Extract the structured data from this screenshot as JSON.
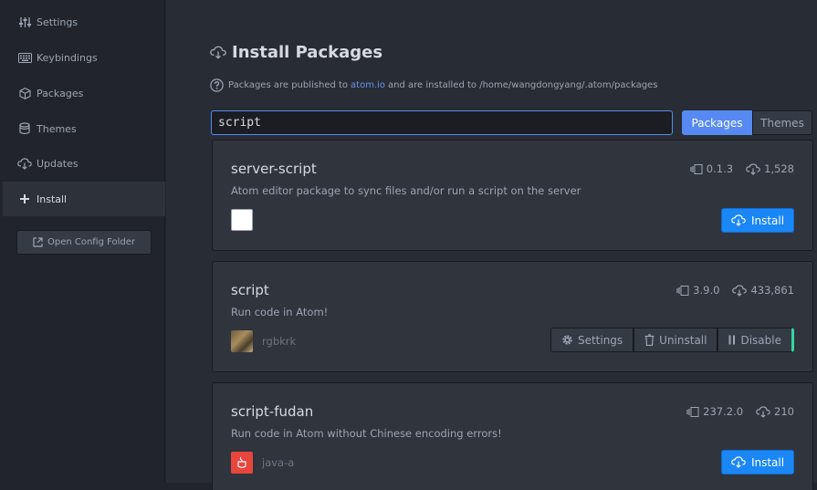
{
  "sidebar": {
    "items": [
      {
        "label": "Settings",
        "icon": "sliders-icon"
      },
      {
        "label": "Keybindings",
        "icon": "keyboard-icon"
      },
      {
        "label": "Packages",
        "icon": "package-icon"
      },
      {
        "label": "Themes",
        "icon": "paintcan-icon"
      },
      {
        "label": "Updates",
        "icon": "cloud-download-icon"
      },
      {
        "label": "Install",
        "icon": "plus-icon"
      }
    ],
    "active": "Install",
    "config_button": "Open Config Folder"
  },
  "main": {
    "title": "Install Packages",
    "info_prefix": "Packages are published to",
    "info_link": "atom.io",
    "info_suffix": "and are installed to /home/wangdongyang/.atom/packages",
    "search_value": "script",
    "toggle": {
      "packages": "Packages",
      "themes": "Themes",
      "selected": "Packages"
    }
  },
  "packages": [
    {
      "name": "server-script",
      "description": "Atom editor package to sync files and/or run a script on the server",
      "version": "0.1.3",
      "downloads": "1,528",
      "owner": "",
      "action": "Install"
    },
    {
      "name": "script",
      "description": "Run code in Atom!",
      "version": "3.9.0",
      "downloads": "433,861",
      "owner": "rgbkrk",
      "settings_label": "Settings",
      "uninstall_label": "Uninstall",
      "disable_label": "Disable"
    },
    {
      "name": "script-fudan",
      "description": "Run code in Atom without Chinese encoding errors!",
      "version": "237.2.0",
      "downloads": "210",
      "owner": "java-a",
      "action": "Install"
    }
  ],
  "colors": {
    "accent": "#568af2",
    "install": "#1b87f5",
    "enabled": "#32d6a0"
  }
}
